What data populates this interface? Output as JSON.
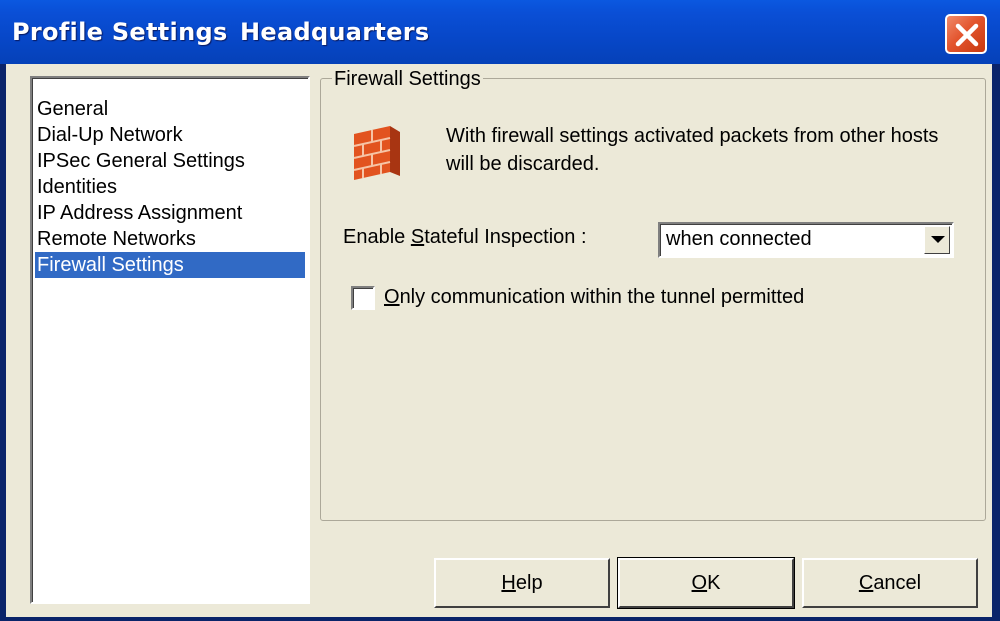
{
  "window": {
    "title": "Profile Settings",
    "profile_name": "Headquarters"
  },
  "sidebar": {
    "items": [
      {
        "label": "General"
      },
      {
        "label": "Dial-Up Network"
      },
      {
        "label": "IPSec General Settings"
      },
      {
        "label": "Identities"
      },
      {
        "label": "IP Address Assignment"
      },
      {
        "label": "Remote Networks"
      },
      {
        "label": "Firewall Settings",
        "selected": true
      }
    ]
  },
  "panel": {
    "group_title": "Firewall Settings",
    "icon": "brick-wall-icon",
    "description": "With firewall settings activated packets from other hosts will be discarded.",
    "stateful": {
      "label_prefix": "Enable ",
      "label_accel": "S",
      "label_rest": "tateful Inspection :",
      "value": "when connected"
    },
    "tunnel_only": {
      "label_accel": "O",
      "label_rest": "nly communication within the tunnel permitted",
      "checked": false
    }
  },
  "buttons": {
    "help": {
      "accel": "H",
      "rest": "elp"
    },
    "ok": {
      "accel": "O",
      "rest": "K"
    },
    "cancel": {
      "accel": "C",
      "rest": "ancel"
    }
  },
  "colors": {
    "titlebar": "#0747c8",
    "selection": "#316ac5",
    "dialog_bg": "#ece9d8",
    "close": "#e3552e"
  }
}
